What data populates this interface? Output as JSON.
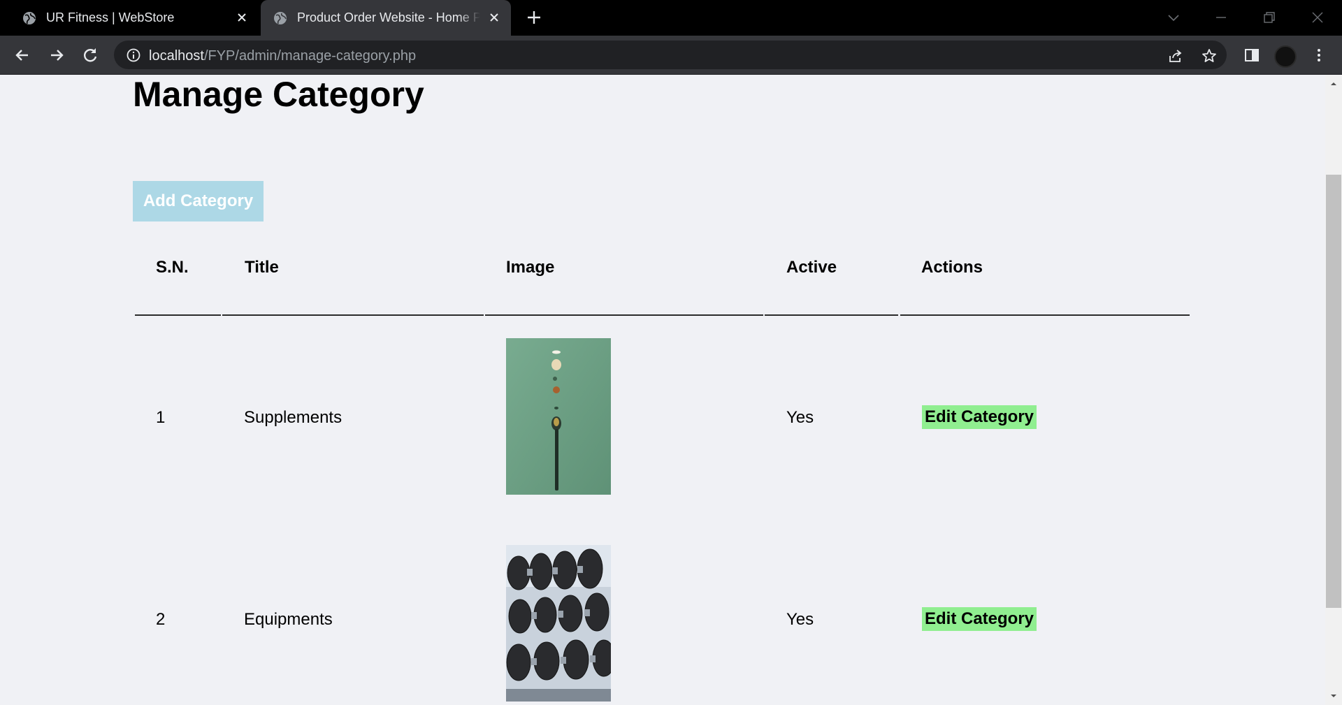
{
  "browser": {
    "tabs": [
      {
        "title": "UR Fitness | WebStore",
        "active": false
      },
      {
        "title": "Product Order Website - Home Page",
        "active": true
      }
    ],
    "url_host": "localhost",
    "url_path": "/FYP/admin/manage-category.php"
  },
  "page": {
    "title": "Manage Category",
    "add_button": "Add Category"
  },
  "table": {
    "headers": [
      "S.N.",
      "Title",
      "Image",
      "Active",
      "Actions"
    ],
    "rows": [
      {
        "sn": "1",
        "title": "Supplements",
        "active": "Yes",
        "action": "Edit Category",
        "image": "supplements-photo"
      },
      {
        "sn": "2",
        "title": "Equipments",
        "active": "Yes",
        "action": "Edit Category",
        "image": "dumbbells-photo"
      }
    ]
  },
  "colors": {
    "page_bg": "#f0f1f5",
    "add_button_bg": "#add8e6",
    "edit_button_bg": "#90ee90",
    "chrome_dark": "#35363a"
  }
}
